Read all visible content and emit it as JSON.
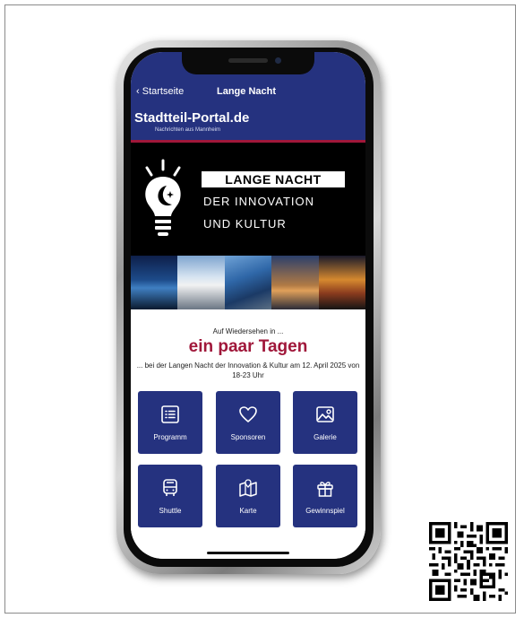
{
  "nav": {
    "back_label": "Startseite",
    "title": "Lange Nacht"
  },
  "portal": {
    "name": "Stadtteil-Portal.de",
    "tagline": "Nachrichten aus Mannheim"
  },
  "event": {
    "line1": "LANGE NACHT",
    "line2": "DER INNOVATION",
    "line3": "UND KULTUR"
  },
  "countdown": {
    "intro": "Auf Wiedersehen in ...",
    "value": "ein paar Tagen",
    "detail": "... bei der Langen Nacht der Innovation & Kultur am 12. April 2025 von 18-23 Uhr"
  },
  "tiles": [
    {
      "label": "Programm",
      "icon": "list-icon"
    },
    {
      "label": "Sponsoren",
      "icon": "heart-icon"
    },
    {
      "label": "Galerie",
      "icon": "image-icon"
    },
    {
      "label": "Shuttle",
      "icon": "bus-icon"
    },
    {
      "label": "Karte",
      "icon": "map-icon"
    },
    {
      "label": "Gewinnspiel",
      "icon": "gift-icon"
    }
  ],
  "colors": {
    "brand_blue": "#25327f",
    "accent_red": "#a0173a",
    "hero_bg": "#000000"
  }
}
